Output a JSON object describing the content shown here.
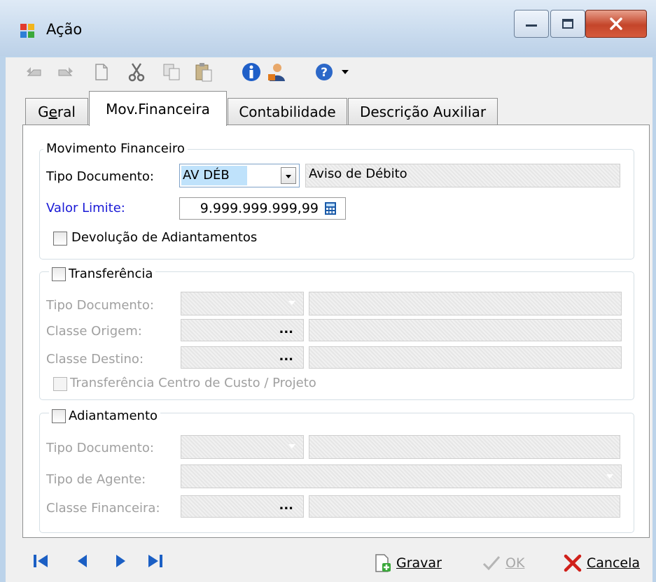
{
  "window": {
    "title": "Ação"
  },
  "toolbar": {
    "icons": [
      "undo-icon",
      "redo-icon",
      "new-document-icon",
      "cut-icon",
      "copy-icon",
      "paste-icon",
      "info-icon",
      "user-icon",
      "help-icon",
      "dropdown-arrow-icon"
    ]
  },
  "tabs": [
    {
      "label": "Geral",
      "accel": "e"
    },
    {
      "label": "Mov.Financeira"
    },
    {
      "label": "Contabilidade"
    },
    {
      "label": "Descrição Auxiliar"
    }
  ],
  "movimento": {
    "group_label": "Movimento Financeiro",
    "tipo_documento_label": "Tipo Documento:",
    "tipo_documento_value": "AV DÉB",
    "tipo_documento_desc": "Aviso de Débito",
    "valor_limite_label": "Valor Limite:",
    "valor_limite_value": "9.999.999.999,99",
    "devolucao_label": "Devolução de Adiantamentos"
  },
  "transferencia": {
    "group_label": "Transferência",
    "tipo_documento_label": "Tipo Documento:",
    "classe_origem_label": "Classe Origem:",
    "classe_destino_label": "Classe Destino:",
    "ellipsis": "...",
    "centro_custo_label": "Transferência Centro de Custo / Projeto"
  },
  "adiantamento": {
    "group_label": "Adiantamento",
    "tipo_documento_label": "Tipo Documento:",
    "tipo_agente_label": "Tipo de Agente:",
    "classe_financeira_label": "Classe Financeira:",
    "ellipsis": "..."
  },
  "actions": {
    "gravar": "Gravar",
    "ok": "OK",
    "cancela": "Cancela"
  },
  "colors": {
    "accent_blue": "#1a1ad6",
    "nav_blue": "#1b5fc4",
    "cancel_red": "#d0201a"
  }
}
